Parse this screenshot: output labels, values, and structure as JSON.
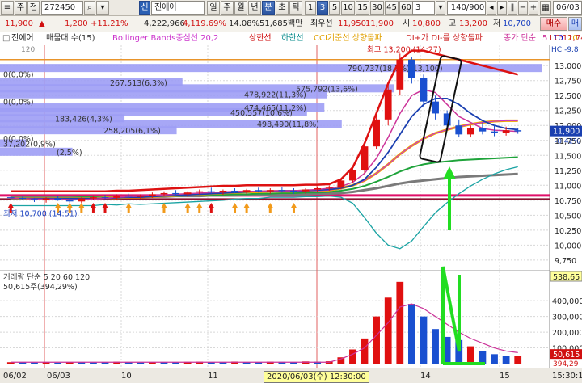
{
  "toolbar": {
    "row1": {
      "button_ju": "주",
      "button_jeon": "전",
      "code": "272450",
      "badge": "신",
      "name": "진에어",
      "period_buttons": [
        "일",
        "주",
        "월",
        "년",
        "분",
        "초",
        "틱"
      ],
      "period_selected": "분",
      "minute_buttons": [
        "1",
        "3",
        "5",
        "10",
        "15",
        "30",
        "45",
        "60"
      ],
      "minute_selected": "3",
      "select_value": "3",
      "count": "140/900",
      "date": "06/03"
    },
    "row2": {
      "price": "11,900",
      "change_arrow": "▲",
      "change": "1,200",
      "change_pct": "+11.21%",
      "volume": "4,222,966",
      "volume_pct": "4,119.69%",
      "turnover_pct": "14.08%",
      "amount": "51,685백만",
      "best_ask_label": "최우선",
      "best_ask": "11,950",
      "best_bid": "11,900",
      "open_label": "시",
      "open": "10,800",
      "high_label": "고",
      "high": "13,200",
      "low_label": "저",
      "low": "10,700",
      "buy_button": "매수",
      "sell_button": "매"
    }
  },
  "legend": {
    "name": "진에어",
    "items": [
      {
        "text": "매물대 수(15)",
        "color": "#333333"
      },
      {
        "text": "Bollinger Bands중심선 20,2",
        "color": "#cc33cc"
      },
      {
        "text": "상한선",
        "color": "#cc0000"
      },
      {
        "text": "하한선",
        "color": "#008888"
      },
      {
        "text": "CCI기준선 상향돌파",
        "color": "#e0a000"
      },
      {
        "text": "DI+가 DI-를 상향돌파",
        "color": "#cc2222"
      },
      {
        "text": "종가 단순",
        "color": "#cc3399"
      },
      {
        "text": "5",
        "color": "#cc3399"
      },
      {
        "text": "10",
        "color": "#0000cc"
      },
      {
        "text": "20",
        "color": "#e0a000"
      }
    ],
    "right_lc": "LC:11,74",
    "right_hc": "HC:-9.8"
  },
  "colors": {
    "up": "#e01010",
    "down": "#1a50d0",
    "ma5": "#cc3399",
    "ma10": "#1a3fb0",
    "ma20": "#f0a800",
    "ma60": "#1ea33a",
    "ma120": "#7a7a7a",
    "bb_mid": "#cc33cc",
    "bb_upper": "#dd1111",
    "bb_lower": "#1aa3a3",
    "volume_profile": "#9d9df5",
    "highlight": "#22dd22",
    "line_high": "#e8942a"
  },
  "chart_data": [
    {
      "type": "candlestick",
      "title": "진에어 (272450) 3분",
      "price_axis": {
        "ticks": [
          "13,000",
          "12,750",
          "12,500",
          "12,250",
          "12,000",
          "11,750",
          "11,500",
          "11,250",
          "11,000",
          "10,750",
          "10,500",
          "10,250",
          "10,000",
          "9,750"
        ],
        "range": [
          9600,
          13340
        ],
        "current": "11,900",
        "current_pct": "-0.42%"
      },
      "top_label": "120",
      "annotation_high": "최고 13,200 (14:27)",
      "annotation_low": "최저 10,700 (14:51)",
      "volume_profile_labels": [
        {
          "text": "790,737(18,7%)(13,100)",
          "price": 12960
        },
        {
          "text": "0(0,0%)",
          "price": 12860
        },
        {
          "text": "267,513(6,3%)",
          "price": 12720
        },
        {
          "text": "575,792(13,6%)",
          "price": 12620
        },
        {
          "text": "478,922(11,3%)",
          "price": 12520
        },
        {
          "text": "0(0,0%)",
          "price": 12400
        },
        {
          "text": "474,465(11,2%)",
          "price": 12300
        },
        {
          "text": "450,557(10,6%)",
          "price": 12220
        },
        {
          "text": "183,426(4,3%)",
          "price": 12120
        },
        {
          "text": "498,490(11,8%)",
          "price": 12030
        },
        {
          "text": "258,205(6,1%)",
          "price": 11920
        },
        {
          "text": "0(0,0%)",
          "price": 11790
        },
        {
          "text": "37,202(0,9%)",
          "price": 11700
        },
        {
          "text": "(2,5%)",
          "price": 11560
        }
      ],
      "volume_profile": [
        {
          "price": 12960,
          "pct": 18.7
        },
        {
          "price": 12860,
          "pct": 0.0
        },
        {
          "price": 12720,
          "pct": 6.3
        },
        {
          "price": 12620,
          "pct": 13.6
        },
        {
          "price": 12520,
          "pct": 11.3
        },
        {
          "price": 12400,
          "pct": 0.0
        },
        {
          "price": 12300,
          "pct": 11.2
        },
        {
          "price": 12220,
          "pct": 10.6
        },
        {
          "price": 12120,
          "pct": 4.3
        },
        {
          "price": 12030,
          "pct": 11.8
        },
        {
          "price": 11920,
          "pct": 6.1
        },
        {
          "price": 11790,
          "pct": 0.0
        },
        {
          "price": 11700,
          "pct": 0.9
        },
        {
          "price": 11560,
          "pct": 2.5
        }
      ],
      "candles": [
        {
          "o": 10800,
          "h": 10830,
          "l": 10760,
          "c": 10790
        },
        {
          "o": 10790,
          "h": 10810,
          "l": 10750,
          "c": 10770
        },
        {
          "o": 10770,
          "h": 10790,
          "l": 10720,
          "c": 10750
        },
        {
          "o": 10750,
          "h": 10800,
          "l": 10710,
          "c": 10780
        },
        {
          "o": 10780,
          "h": 10820,
          "l": 10740,
          "c": 10760
        },
        {
          "o": 10760,
          "h": 10790,
          "l": 10700,
          "c": 10730
        },
        {
          "o": 10730,
          "h": 10800,
          "l": 10700,
          "c": 10780
        },
        {
          "o": 10780,
          "h": 10820,
          "l": 10750,
          "c": 10800
        },
        {
          "o": 10800,
          "h": 10840,
          "l": 10770,
          "c": 10790
        },
        {
          "o": 10790,
          "h": 10850,
          "l": 10760,
          "c": 10830
        },
        {
          "o": 10830,
          "h": 10860,
          "l": 10790,
          "c": 10810
        },
        {
          "o": 10810,
          "h": 10850,
          "l": 10780,
          "c": 10820
        },
        {
          "o": 10820,
          "h": 10880,
          "l": 10790,
          "c": 10850
        },
        {
          "o": 10850,
          "h": 10900,
          "l": 10820,
          "c": 10870
        },
        {
          "o": 10870,
          "h": 10920,
          "l": 10830,
          "c": 10850
        },
        {
          "o": 10850,
          "h": 10900,
          "l": 10810,
          "c": 10880
        },
        {
          "o": 10880,
          "h": 10930,
          "l": 10850,
          "c": 10900
        },
        {
          "o": 10900,
          "h": 10960,
          "l": 10860,
          "c": 10880
        },
        {
          "o": 10880,
          "h": 10930,
          "l": 10840,
          "c": 10910
        },
        {
          "o": 10910,
          "h": 10950,
          "l": 10870,
          "c": 10890
        },
        {
          "o": 10890,
          "h": 10940,
          "l": 10850,
          "c": 10920
        },
        {
          "o": 10920,
          "h": 10960,
          "l": 10880,
          "c": 10900
        },
        {
          "o": 10900,
          "h": 10950,
          "l": 10860,
          "c": 10920
        },
        {
          "o": 10920,
          "h": 10970,
          "l": 10880,
          "c": 10910
        },
        {
          "o": 10910,
          "h": 10950,
          "l": 10860,
          "c": 10900
        },
        {
          "o": 10900,
          "h": 10950,
          "l": 10860,
          "c": 10930
        },
        {
          "o": 10930,
          "h": 10980,
          "l": 10890,
          "c": 10950
        },
        {
          "o": 10950,
          "h": 11000,
          "l": 10910,
          "c": 10960
        },
        {
          "o": 10960,
          "h": 11100,
          "l": 10930,
          "c": 11080
        },
        {
          "o": 11080,
          "h": 11300,
          "l": 11050,
          "c": 11250
        },
        {
          "o": 11250,
          "h": 11700,
          "l": 11200,
          "c": 11650
        },
        {
          "o": 11650,
          "h": 12200,
          "l": 11600,
          "c": 12100
        },
        {
          "o": 12100,
          "h": 12700,
          "l": 12000,
          "c": 12600
        },
        {
          "o": 12600,
          "h": 13200,
          "l": 12500,
          "c": 13100
        },
        {
          "o": 13100,
          "h": 13150,
          "l": 12700,
          "c": 12800
        },
        {
          "o": 12800,
          "h": 12850,
          "l": 12300,
          "c": 12400
        },
        {
          "o": 12400,
          "h": 12500,
          "l": 12100,
          "c": 12200
        },
        {
          "o": 12200,
          "h": 12250,
          "l": 11950,
          "c": 12000
        },
        {
          "o": 12000,
          "h": 12100,
          "l": 11800,
          "c": 11850
        },
        {
          "o": 11850,
          "h": 12000,
          "l": 11800,
          "c": 11950
        },
        {
          "o": 11950,
          "h": 12050,
          "l": 11850,
          "c": 11900
        },
        {
          "o": 11900,
          "h": 12000,
          "l": 11820,
          "c": 11880
        },
        {
          "o": 11880,
          "h": 11980,
          "l": 11830,
          "c": 11920
        },
        {
          "o": 11920,
          "h": 11960,
          "l": 11860,
          "c": 11900
        }
      ],
      "ma": {
        "ma120": [
          10800,
          10800,
          10800,
          10800,
          10800,
          10800,
          10800,
          10800,
          10800,
          10800,
          10810,
          10810,
          10810,
          10810,
          10820,
          10820,
          10820,
          10830,
          10830,
          10830,
          10840,
          10840,
          10840,
          10850,
          10850,
          10850,
          10860,
          10860,
          10870,
          10890,
          10920,
          10950,
          10990,
          11030,
          11060,
          11080,
          11100,
          11120,
          11140,
          11150,
          11160,
          11170,
          11180,
          11190
        ],
        "ma60": [
          10790,
          10790,
          10790,
          10790,
          10790,
          10790,
          10800,
          10800,
          10800,
          10800,
          10810,
          10810,
          10810,
          10820,
          10820,
          10830,
          10830,
          10840,
          10840,
          10850,
          10850,
          10860,
          10860,
          10870,
          10870,
          10880,
          10880,
          10890,
          10910,
          10940,
          10990,
          11060,
          11140,
          11230,
          11300,
          11350,
          11380,
          11400,
          11420,
          11430,
          11440,
          11450,
          11460,
          11470
        ],
        "ma20": [
          10780,
          10780,
          10780,
          10780,
          10780,
          10780,
          10780,
          10780,
          10790,
          10790,
          10800,
          10800,
          10810,
          10820,
          10830,
          10840,
          10850,
          10860,
          10870,
          10880,
          10890,
          10890,
          10900,
          10900,
          10900,
          10910,
          10910,
          10920,
          10950,
          11000,
          11080,
          11200,
          11350,
          11520,
          11660,
          11780,
          11870,
          11930,
          11980,
          12020,
          12050,
          12070,
          12080,
          12080
        ],
        "ma5": [
          10790,
          10780,
          10770,
          10770,
          10770,
          10760,
          10760,
          10770,
          10780,
          10800,
          10810,
          10820,
          10830,
          10840,
          10850,
          10860,
          10870,
          10880,
          10890,
          10900,
          10900,
          10900,
          10910,
          10910,
          10910,
          10920,
          10930,
          10950,
          10980,
          11050,
          11200,
          11450,
          11800,
          12200,
          12500,
          12600,
          12550,
          12350,
          12150,
          12050,
          11950,
          11920,
          11910,
          11900
        ],
        "ma10": [
          10780,
          10780,
          10780,
          10780,
          10780,
          10780,
          10780,
          10780,
          10780,
          10790,
          10800,
          10800,
          10810,
          10820,
          10830,
          10840,
          10850,
          10860,
          10870,
          10880,
          10890,
          10900,
          10900,
          10910,
          10910,
          10910,
          10920,
          10930,
          10950,
          11000,
          11100,
          11300,
          11550,
          11850,
          12150,
          12350,
          12450,
          12450,
          12350,
          12200,
          12080,
          12000,
          11950,
          11930
        ]
      },
      "bollinger": {
        "upper": [
          10900,
          10900,
          10900,
          10900,
          10900,
          10900,
          10900,
          10900,
          10900,
          10910,
          10910,
          10920,
          10930,
          10940,
          10950,
          10960,
          10970,
          10980,
          10990,
          10990,
          11000,
          11000,
          11000,
          11000,
          11000,
          11010,
          11010,
          11020,
          11100,
          11300,
          11700,
          12200,
          12700,
          13100,
          13250,
          13250,
          13200,
          13150,
          13100,
          13050,
          13000,
          12950,
          12900,
          12850
        ],
        "middle": [
          10780,
          10780,
          10780,
          10780,
          10780,
          10780,
          10780,
          10780,
          10790,
          10790,
          10800,
          10800,
          10810,
          10820,
          10830,
          10840,
          10850,
          10860,
          10870,
          10880,
          10890,
          10890,
          10900,
          10900,
          10900,
          10910,
          10910,
          10920,
          10950,
          11000,
          11080,
          11200,
          11350,
          11520,
          11660,
          11780,
          11870,
          11930,
          11980,
          12020,
          12050,
          12070,
          12080,
          12080
        ],
        "lower": [
          10660,
          10660,
          10660,
          10660,
          10660,
          10660,
          10660,
          10660,
          10680,
          10670,
          10690,
          10680,
          10690,
          10700,
          10710,
          10720,
          10730,
          10740,
          10750,
          10770,
          10780,
          10780,
          10800,
          10800,
          10800,
          10810,
          10810,
          10820,
          10800,
          10700,
          10460,
          10200,
          10000,
          9940,
          10070,
          10310,
          10540,
          10710,
          10860,
          10990,
          11100,
          11190,
          11260,
          11310
        ]
      },
      "signals": [
        {
          "i": 0,
          "kind": "up-red"
        },
        {
          "i": 4,
          "kind": "up-orange"
        },
        {
          "i": 5,
          "kind": "up-orange"
        },
        {
          "i": 6,
          "kind": "up-orange"
        },
        {
          "i": 7,
          "kind": "up-red"
        },
        {
          "i": 8,
          "kind": "up-red"
        },
        {
          "i": 10,
          "kind": "up-orange"
        },
        {
          "i": 13,
          "kind": "up-orange"
        },
        {
          "i": 15,
          "kind": "up-orange"
        },
        {
          "i": 16,
          "kind": "up-orange"
        },
        {
          "i": 17,
          "kind": "up-red"
        },
        {
          "i": 19,
          "kind": "up-orange"
        },
        {
          "i": 20,
          "kind": "up-orange"
        },
        {
          "i": 22,
          "kind": "up-orange"
        },
        {
          "i": 24,
          "kind": "up-orange"
        }
      ]
    },
    {
      "type": "bar",
      "title": "거래량 단순 5 20 60 120",
      "volume_label": "50,615주(394,29%)",
      "axis_ticks": [
        "400,000",
        "300,000",
        "200,000",
        "100,000"
      ],
      "ma_box_value": "538,65",
      "last_value": "50,615",
      "last_pct": "394,29",
      "ylim": [
        0,
        550000
      ],
      "values": [
        9000,
        8000,
        7000,
        9000,
        6000,
        10000,
        8000,
        7000,
        9000,
        12000,
        8000,
        7000,
        10000,
        9000,
        8000,
        11000,
        12000,
        9000,
        10000,
        13000,
        9000,
        10000,
        12000,
        11000,
        9000,
        14000,
        12000,
        15000,
        40000,
        90000,
        160000,
        300000,
        420000,
        520000,
        380000,
        300000,
        220000,
        170000,
        150000,
        110000,
        80000,
        60000,
        50000,
        50615
      ],
      "ma5": [
        9000,
        9000,
        9000,
        9000,
        9000,
        9000,
        9000,
        9000,
        9000,
        9000,
        9000,
        9000,
        9000,
        9000,
        9000,
        9000,
        9000,
        9000,
        9000,
        9000,
        9000,
        9000,
        9000,
        9000,
        9000,
        9000,
        9000,
        9000,
        30000,
        60000,
        100000,
        180000,
        260000,
        360000,
        380000,
        350000,
        300000,
        250000,
        200000,
        160000,
        130000,
        100000,
        80000,
        70000
      ],
      "up_indices": [
        0,
        3,
        5,
        9,
        12,
        15,
        16,
        19,
        22,
        25,
        27,
        28,
        29,
        30,
        31,
        32,
        33,
        39,
        43
      ],
      "down_indices": [
        1,
        2,
        4,
        6,
        7,
        8,
        10,
        11,
        13,
        14,
        17,
        18,
        20,
        21,
        23,
        24,
        26,
        34,
        35,
        36,
        37,
        38,
        40,
        41,
        42
      ]
    }
  ],
  "time_axis": {
    "labels": [
      {
        "text": "06/02",
        "slot": 0
      },
      {
        "text": "06/03",
        "slot": 1
      },
      {
        "text": "10",
        "slot": 2
      },
      {
        "text": "11",
        "slot": 3
      },
      {
        "text": "14",
        "slot": 4
      },
      {
        "text": "15",
        "slot": 5
      }
    ],
    "crosshair_label": "2020/06/03(수) 12:30:00",
    "right_label": "15:30:1"
  }
}
